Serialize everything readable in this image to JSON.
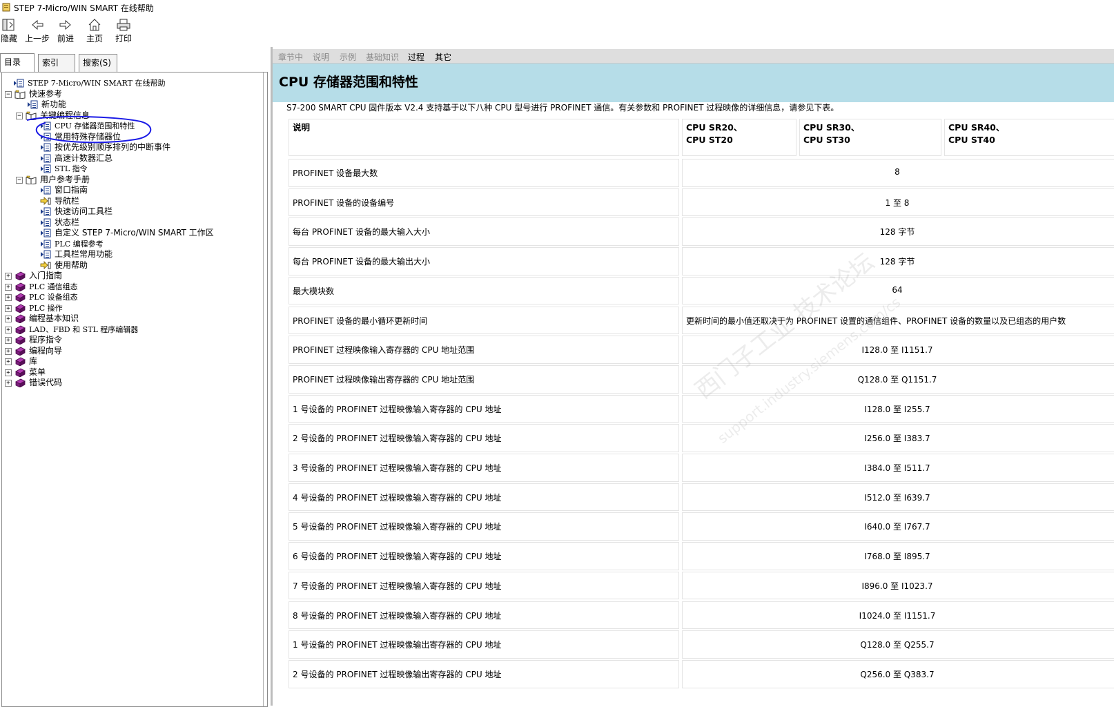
{
  "window": {
    "title": "STEP 7-Micro/WIN SMART 在线帮助",
    "icon": "help-book-icon"
  },
  "toolbar": {
    "buttons": [
      {
        "label": "隐藏",
        "icon": "hide-pane-icon"
      },
      {
        "label": "上一步",
        "icon": "back-arrow-icon"
      },
      {
        "label": "前进",
        "icon": "forward-arrow-icon"
      },
      {
        "label": "主页",
        "icon": "home-icon"
      },
      {
        "label": "打印",
        "icon": "printer-icon"
      }
    ]
  },
  "left_tabs": [
    {
      "label": "目录(C)",
      "active": true
    },
    {
      "label": "索引(N)",
      "active": false
    },
    {
      "label": "搜索(S)",
      "active": false
    }
  ],
  "tree": [
    {
      "label": "STEP 7-Micro/WIN SMART 在线帮助",
      "level": 0,
      "expander": "",
      "icon": "page-icon"
    },
    {
      "label": "快速参考",
      "level": 0,
      "expander": "−",
      "icon": "open-book-icon"
    },
    {
      "label": "新功能",
      "level": 1,
      "expander": "",
      "icon": "page-icon"
    },
    {
      "label": "关键编程信息",
      "level": 1,
      "expander": "−",
      "icon": "open-book-icon"
    },
    {
      "label": "CPU 存储器范围和特性",
      "level": 2,
      "expander": "",
      "icon": "page-icon"
    },
    {
      "label": "常用特殊存储器位",
      "level": 2,
      "expander": "",
      "icon": "page-icon"
    },
    {
      "label": "按优先级别顺序排列的中断事件",
      "level": 2,
      "expander": "",
      "icon": "page-icon"
    },
    {
      "label": "高速计数器汇总",
      "level": 2,
      "expander": "",
      "icon": "page-icon"
    },
    {
      "label": "STL 指令",
      "level": 2,
      "expander": "",
      "icon": "page-icon"
    },
    {
      "label": "用户参考手册",
      "level": 1,
      "expander": "−",
      "icon": "open-book-icon"
    },
    {
      "label": "窗口指南",
      "level": 2,
      "expander": "",
      "icon": "page-icon"
    },
    {
      "label": "导航栏",
      "level": 2,
      "expander": "",
      "icon": "link-page-icon"
    },
    {
      "label": "快速访问工具栏",
      "level": 2,
      "expander": "",
      "icon": "page-icon"
    },
    {
      "label": "状态栏",
      "level": 2,
      "expander": "",
      "icon": "page-icon"
    },
    {
      "label": "自定义 STEP 7-Micro/WIN SMART 工作区",
      "level": 2,
      "expander": "",
      "icon": "page-icon"
    },
    {
      "label": "PLC 编程参考",
      "level": 2,
      "expander": "",
      "icon": "page-icon"
    },
    {
      "label": "工具栏常用功能",
      "level": 2,
      "expander": "",
      "icon": "page-icon"
    },
    {
      "label": "使用帮助",
      "level": 2,
      "expander": "",
      "icon": "link-page-icon"
    },
    {
      "label": "入门指南",
      "level": 0,
      "expander": "+",
      "icon": "closed-book-icon"
    },
    {
      "label": "PLC 通信组态",
      "level": 0,
      "expander": "+",
      "icon": "closed-book-icon"
    },
    {
      "label": "PLC 设备组态",
      "level": 0,
      "expander": "+",
      "icon": "closed-book-icon"
    },
    {
      "label": "PLC 操作",
      "level": 0,
      "expander": "+",
      "icon": "closed-book-icon"
    },
    {
      "label": "编程基本知识",
      "level": 0,
      "expander": "+",
      "icon": "closed-book-icon"
    },
    {
      "label": "LAD、FBD 和 STL 程序编辑器",
      "level": 0,
      "expander": "+",
      "icon": "closed-book-icon"
    },
    {
      "label": "程序指令",
      "level": 0,
      "expander": "+",
      "icon": "closed-book-icon"
    },
    {
      "label": "编程向导",
      "level": 0,
      "expander": "+",
      "icon": "closed-book-icon"
    },
    {
      "label": "库",
      "level": 0,
      "expander": "+",
      "icon": "closed-book-icon"
    },
    {
      "label": "菜单",
      "level": 0,
      "expander": "+",
      "icon": "closed-book-icon"
    },
    {
      "label": "错误代码",
      "level": 0,
      "expander": "+",
      "icon": "closed-book-icon"
    }
  ],
  "nav_links": [
    {
      "label": "章节中",
      "active": false
    },
    {
      "label": "说明",
      "active": false
    },
    {
      "label": "示例",
      "active": false
    },
    {
      "label": "基础知识",
      "active": false
    },
    {
      "label": "过程",
      "active": true
    },
    {
      "label": "其它",
      "active": true
    }
  ],
  "content": {
    "title": "CPU 存储器范围和特性",
    "intro": "S7-200 SMART CPU 固件版本 V2.4 支持基于以下八种 CPU 型号进行 PROFINET 通信。有关参数和 PROFINET 过程映像的详细信息，请参见下表。",
    "table": {
      "headers": [
        {
          "line1": "说明",
          "line2": ""
        },
        {
          "line1": "CPU SR20、",
          "line2": "CPU ST20"
        },
        {
          "line1": "CPU SR30、",
          "line2": "CPU ST30"
        },
        {
          "line1": "CPU SR40、",
          "line2": "CPU ST40"
        }
      ],
      "rows": [
        {
          "desc": "PROFINET 设备最大数",
          "value": "8"
        },
        {
          "desc": "PROFINET 设备的设备编号",
          "value": "1 至 8"
        },
        {
          "desc": "每台 PROFINET 设备的最大输入大小",
          "value": "128 字节"
        },
        {
          "desc": "每台 PROFINET 设备的最大输出大小",
          "value": "128 字节"
        },
        {
          "desc": "最大模块数",
          "value": "64"
        },
        {
          "desc": "PROFINET 设备的最小循环更新时间",
          "value": "更新时间的最小值还取决于为 PROFINET 设置的通信组件、PROFINET 设备的数量以及已组态的用户数"
        },
        {
          "desc": "PROFINET 过程映像输入寄存器的 CPU 地址范围",
          "value": "I128.0 至 I1151.7"
        },
        {
          "desc": "PROFINET 过程映像输出寄存器的 CPU 地址范围",
          "value": "Q128.0 至 Q1151.7"
        },
        {
          "desc": "1 号设备的 PROFINET 过程映像输入寄存器的 CPU 地址",
          "value": "I128.0 至 I255.7"
        },
        {
          "desc": "2 号设备的 PROFINET 过程映像输入寄存器的 CPU 地址",
          "value": "I256.0 至 I383.7"
        },
        {
          "desc": "3 号设备的 PROFINET 过程映像输入寄存器的 CPU 地址",
          "value": "I384.0 至 I511.7"
        },
        {
          "desc": "4 号设备的 PROFINET 过程映像输入寄存器的 CPU 地址",
          "value": "I512.0 至 I639.7"
        },
        {
          "desc": "5 号设备的 PROFINET 过程映像输入寄存器的 CPU 地址",
          "value": "I640.0 至 I767.7"
        },
        {
          "desc": "6 号设备的 PROFINET 过程映像输入寄存器的 CPU 地址",
          "value": "I768.0 至 I895.7"
        },
        {
          "desc": "7 号设备的 PROFINET 过程映像输入寄存器的 CPU 地址",
          "value": "I896.0 至 I1023.7"
        },
        {
          "desc": "8 号设备的 PROFINET 过程映像输入寄存器的 CPU 地址",
          "value": "I1024.0 至 I1151.7"
        },
        {
          "desc": "1 号设备的 PROFINET 过程映像输出寄存器的 CPU 地址",
          "value": "Q128.0 至 Q255.7"
        },
        {
          "desc": "2 号设备的 PROFINET 过程映像输出寄存器的 CPU 地址",
          "value": "Q256.0 至 Q383.7"
        }
      ]
    }
  },
  "watermark": {
    "line1": "西门子工业 技术论坛",
    "line2": "support.industry.siemens.com/cs"
  },
  "colors": {
    "banner": "#b6dde8",
    "annotation_circle": "#1a1ae6",
    "book_closed": "#7a1e7a",
    "page_icon": "#1a3a8a"
  }
}
